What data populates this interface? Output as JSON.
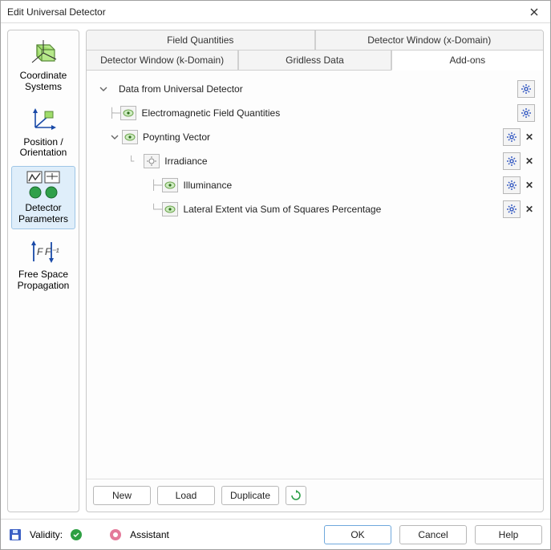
{
  "window": {
    "title": "Edit Universal Detector"
  },
  "sidebar": {
    "items": [
      {
        "label": "Coordinate Systems"
      },
      {
        "label": "Position / Orientation"
      },
      {
        "label": "Detector Parameters"
      },
      {
        "label": "Free Space Propagation"
      }
    ]
  },
  "tabs": {
    "row1": [
      {
        "label": "Field Quantities"
      },
      {
        "label": "Detector Window (x-Domain)"
      }
    ],
    "row2": [
      {
        "label": "Detector Window (k-Domain)"
      },
      {
        "label": "Gridless Data"
      },
      {
        "label": "Add-ons"
      }
    ]
  },
  "tree": {
    "root": "Data from Universal Detector",
    "items": [
      {
        "label": "Electromagnetic Field Quantities"
      },
      {
        "label": "Poynting Vector"
      },
      {
        "label": "Irradiance"
      },
      {
        "label": "Illuminance"
      },
      {
        "label": "Lateral Extent via Sum of Squares Percentage"
      }
    ]
  },
  "toolbar": {
    "new": "New",
    "load": "Load",
    "duplicate": "Duplicate"
  },
  "footer": {
    "validity": "Validity:",
    "assistant": "Assistant",
    "ok": "OK",
    "cancel": "Cancel",
    "help": "Help"
  }
}
